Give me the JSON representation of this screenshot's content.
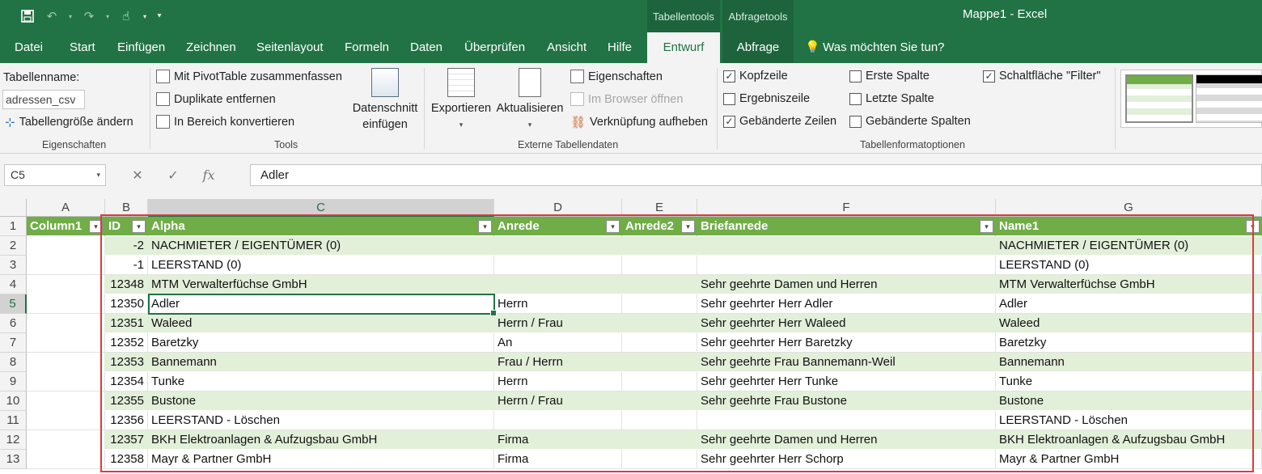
{
  "qat": {
    "save_icon": "save-icon",
    "undo_icon": "undo-icon",
    "redo_icon": "redo-icon",
    "touch_icon": "touch-mode-icon"
  },
  "title": {
    "context_tab_1": "Tabellentools",
    "context_tab_2": "Abfragetools",
    "app_title": "Mappe1  -  Excel"
  },
  "tabs": [
    "Datei",
    "Start",
    "Einfügen",
    "Zeichnen",
    "Seitenlayout",
    "Formeln",
    "Daten",
    "Überprüfen",
    "Ansicht",
    "Hilfe",
    "Entwurf",
    "Abfrage"
  ],
  "tell_me": "Was möchten Sie tun?",
  "ribbon": {
    "eigenschaften": {
      "label": "Eigenschaften",
      "table_name_label": "Tabellenname:",
      "table_name_value": "adressen_csv",
      "resize": "Tabellengröße ändern"
    },
    "tools": {
      "label": "Tools",
      "pivot": "Mit PivotTable zusammenfassen",
      "dups": "Duplikate entfernen",
      "convert": "In Bereich konvertieren",
      "slicer_1": "Datenschnitt",
      "slicer_2": "einfügen"
    },
    "extern": {
      "label": "Externe Tabellendaten",
      "export": "Exportieren",
      "refresh": "Aktualisieren",
      "props": "Eigenschaften",
      "browser": "Im Browser öffnen",
      "unlink": "Verknüpfung aufheben"
    },
    "options": {
      "label": "Tabellenformatoptionen",
      "header_row": "Kopfzeile",
      "total_row": "Ergebniszeile",
      "banded_rows": "Gebänderte Zeilen",
      "first_col": "Erste Spalte",
      "last_col": "Letzte Spalte",
      "banded_cols": "Gebänderte Spalten",
      "filter_btn": "Schaltfläche \"Filter\"",
      "checked": {
        "header_row": true,
        "total_row": false,
        "banded_rows": true,
        "first_col": false,
        "last_col": false,
        "banded_cols": false,
        "filter_btn": true
      }
    }
  },
  "formula_bar": {
    "name_box": "C5",
    "content": "Adler"
  },
  "columns": [
    "A",
    "B",
    "C",
    "D",
    "E",
    "F",
    "G"
  ],
  "table_headers": [
    "Column1",
    "ID",
    "Alpha",
    "Anrede",
    "Anrede2",
    "Briefanrede",
    "Name1"
  ],
  "row_numbers": [
    "1",
    "2",
    "3",
    "4",
    "5",
    "6",
    "7",
    "8",
    "9",
    "10",
    "11",
    "12",
    "13"
  ],
  "rows": [
    [
      "",
      "-2",
      "NACHMIETER / EIGENTÜMER (0)",
      "",
      "",
      "",
      "NACHMIETER / EIGENTÜMER (0)"
    ],
    [
      "",
      "-1",
      "LEERSTAND (0)",
      "",
      "",
      "",
      "LEERSTAND (0)"
    ],
    [
      "",
      "12348",
      "MTM Verwalterfüchse GmbH",
      "",
      "",
      "Sehr geehrte Damen und Herren",
      "MTM Verwalterfüchse GmbH"
    ],
    [
      "",
      "12350",
      "Adler",
      "Herrn",
      "",
      "Sehr geehrter Herr Adler",
      "Adler"
    ],
    [
      "",
      "12351",
      "Waleed",
      "Herrn / Frau",
      "",
      "Sehr geehrter Herr Waleed",
      "Waleed"
    ],
    [
      "",
      "12352",
      "Baretzky",
      "An",
      "",
      "Sehr geehrter Herr Baretzky",
      "Baretzky"
    ],
    [
      "",
      "12353",
      "Bannemann",
      "Frau / Herrn",
      "",
      "Sehr geehrte Frau Bannemann-Weil",
      "Bannemann"
    ],
    [
      "",
      "12354",
      "Tunke",
      "Herrn",
      "",
      "Sehr geehrter Herr Tunke",
      "Tunke"
    ],
    [
      "",
      "12355",
      "Bustone",
      "Herrn / Frau",
      "",
      "Sehr geehrte Frau Bustone",
      "Bustone"
    ],
    [
      "",
      "12356",
      "LEERSTAND - Löschen",
      "",
      "",
      "",
      "LEERSTAND - Löschen"
    ],
    [
      "",
      "12357",
      "BKH Elektroanlagen & Aufzugsbau GmbH",
      "Firma",
      "",
      "Sehr geehrte Damen und Herren",
      "BKH Elektroanlagen & Aufzugsbau GmbH"
    ],
    [
      "",
      "12358",
      "Mayr & Partner GmbH",
      "Firma",
      "",
      "Sehr geehrter Herr Schorp",
      "Mayr & Partner GmbH"
    ]
  ],
  "colors": {
    "excel_green": "#217346",
    "table_header": "#70ad47",
    "band": "#e2efd9",
    "highlight": "#e0393e"
  }
}
